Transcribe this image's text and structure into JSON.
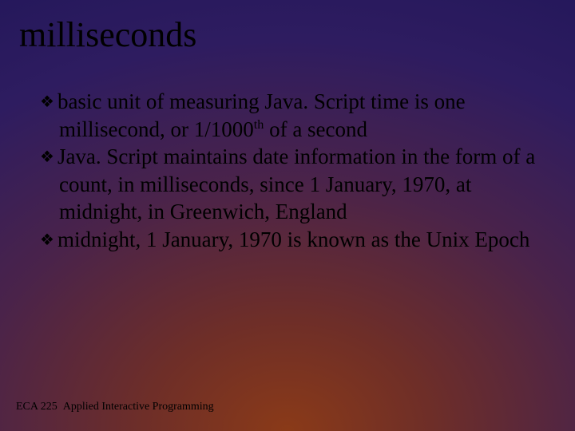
{
  "title": "milliseconds",
  "bullets": [
    {
      "pre": "basic unit of measuring Java. Script time is one millisecond, or 1/1000",
      "sup": "th",
      "post": " of a second"
    },
    {
      "pre": "Java. Script maintains date information in the form of a count, in milliseconds, since 1 January, 1970, at midnight, in Greenwich, England",
      "sup": "",
      "post": ""
    },
    {
      "pre": "midnight, 1 January, 1970 is known as the Unix Epoch",
      "sup": "",
      "post": ""
    }
  ],
  "footer": {
    "course": "ECA 225",
    "name": "Applied Interactive Programming"
  },
  "glyphs": {
    "bullet": "❖"
  }
}
